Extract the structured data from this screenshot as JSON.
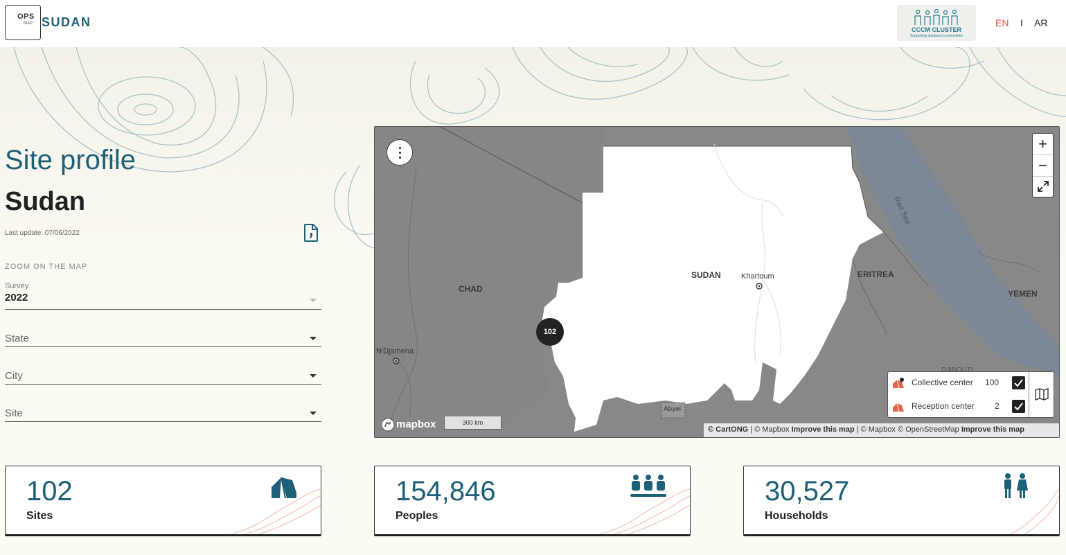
{
  "header": {
    "logo_ops": "OPS",
    "logo_map": "MAP",
    "logo_country": "SUDAN",
    "partner": {
      "title": "CCCM CLUSTER",
      "subtitle": "Supporting displaced communities"
    },
    "languages": [
      {
        "label": "EN",
        "active": true
      },
      {
        "label": "I",
        "active": false
      },
      {
        "label": "AR",
        "active": false
      }
    ]
  },
  "page": {
    "title": "Site profile",
    "country": "Sudan",
    "last_update": "Last update: 07/06/2022"
  },
  "filters": {
    "section_label": "ZOOM ON THE MAP",
    "survey": {
      "label": "Survey",
      "value": "2022"
    },
    "state": {
      "placeholder": "State"
    },
    "city": {
      "placeholder": "City"
    },
    "site": {
      "placeholder": "Site"
    }
  },
  "map": {
    "labels": {
      "sudan": "SUDAN",
      "khartoum": "Khartoum",
      "chad": "CHAD",
      "ndjamena": "N'Djamena",
      "eritrea": "ERITREA",
      "yemen": "YEMEN",
      "red_sea": "Red Sea",
      "abyei": "Abyei",
      "djibouti": "DJIBOUTI"
    },
    "cluster_count": "102",
    "zoom_in": "+",
    "zoom_out": "−",
    "legend": [
      {
        "label": "Collective center",
        "count": "100",
        "checked": true
      },
      {
        "label": "Reception center",
        "count": "2",
        "checked": true
      }
    ],
    "mapbox_logo": "mapbox",
    "scale": "300 km",
    "attribution": {
      "cartong": "© CartONG",
      "sep1": " | © Mapbox ",
      "improve1": "Improve this map",
      "sep2": " | © Mapbox © OpenStreetMap ",
      "improve2": "Improve this map"
    },
    "marker_color": "#e8654a"
  },
  "stats": [
    {
      "value": "102",
      "label": "Sites",
      "icon": "tent-icon"
    },
    {
      "value": "154,846",
      "label": "Peoples",
      "icon": "people-group-icon"
    },
    {
      "value": "30,527",
      "label": "Households",
      "icon": "family-icon"
    }
  ],
  "colors": {
    "accent": "#1e6077",
    "language_active": "#e8534a"
  }
}
